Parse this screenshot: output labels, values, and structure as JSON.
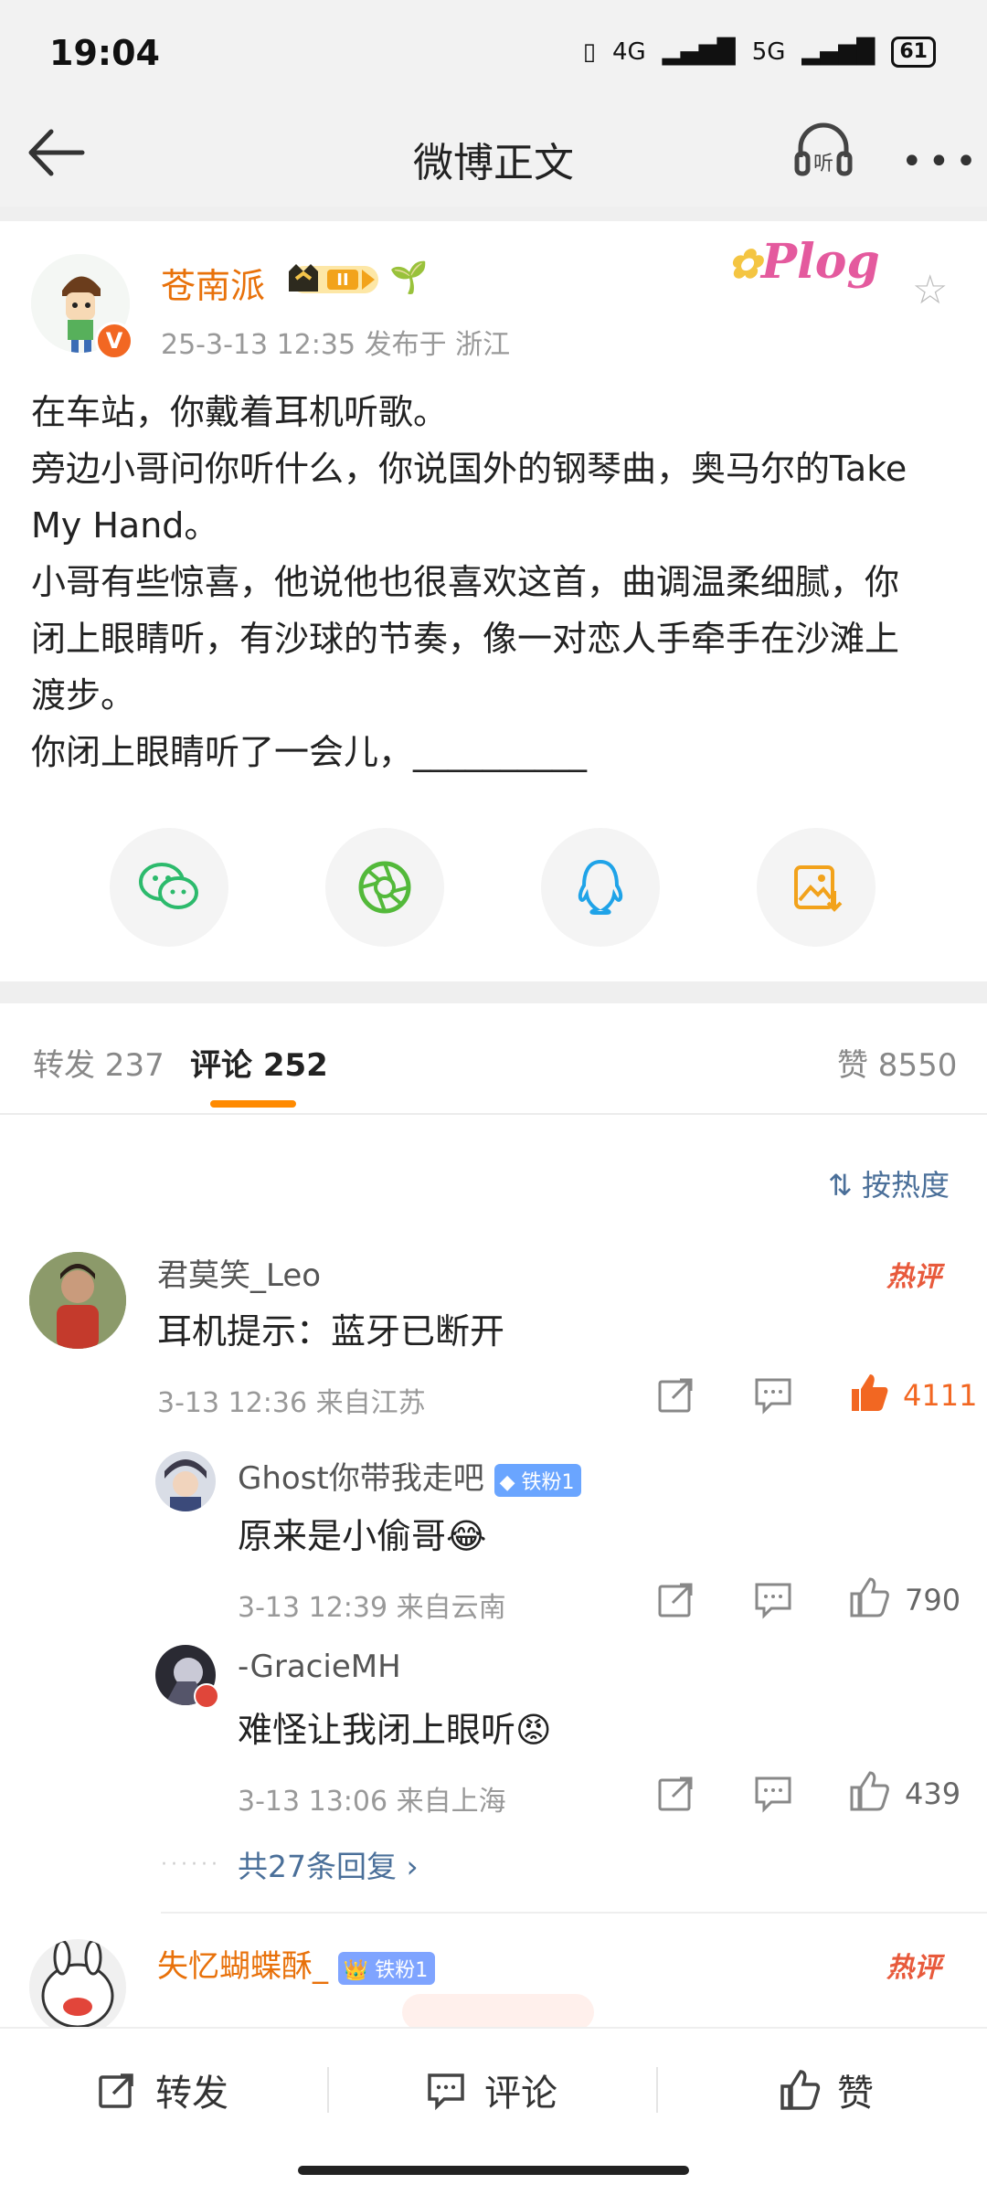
{
  "status_bar": {
    "time": "19:04",
    "network_1": "4G",
    "network_2": "5G",
    "battery": "61"
  },
  "nav": {
    "title": "微博正文"
  },
  "post": {
    "author": "苍南派",
    "meta": "25-3-13 12:35  发布于 浙江",
    "sticker_text": "Plog",
    "lines": [
      "在车站，你戴着耳机听歌。",
      "旁边小哥问你听什么，你说国外的钢琴曲，奥马尔的Take",
      "My Hand。",
      "小哥有些惊喜，他说他也很喜欢这首，曲调温柔细腻，你",
      "闭上眼睛听，有沙球的节奏，像一对恋人手牵手在沙滩上",
      "渡步。",
      "你闭上眼睛听了一会儿，__________"
    ]
  },
  "tabs": {
    "repost": "转发 237",
    "comment": "评论 252",
    "like": "赞 8550"
  },
  "sort_label": "按热度",
  "comments": [
    {
      "name": "君莫笑_Leo",
      "text": "耳机提示：蓝牙已断开",
      "meta": "3-13 12:36  来自江苏",
      "likes": "4111",
      "hot_label": "热评"
    },
    {
      "name": "失忆蝴蝶酥_",
      "fan_badge": "铁粉1",
      "hot_label": "热评"
    }
  ],
  "replies": [
    {
      "name": "Ghost你带我走吧",
      "fan_badge": "铁粉1",
      "text": "原来是小偷哥😂",
      "meta": "3-13 12:39  来自云南",
      "likes": "790"
    },
    {
      "name": "-GracieMH",
      "text": "难怪让我闭上眼听😡",
      "meta": "3-13 13:06  来自上海",
      "likes": "439"
    }
  ],
  "more_replies": "共27条回复 ›",
  "bottom_bar": {
    "repost": "转发",
    "comment": "评论",
    "like": "赞"
  },
  "colors": {
    "accent": "#ff8a00",
    "author": "#e8710a",
    "link": "#4a6f99",
    "hot": "#e85a3c",
    "like_active": "#f26722"
  }
}
